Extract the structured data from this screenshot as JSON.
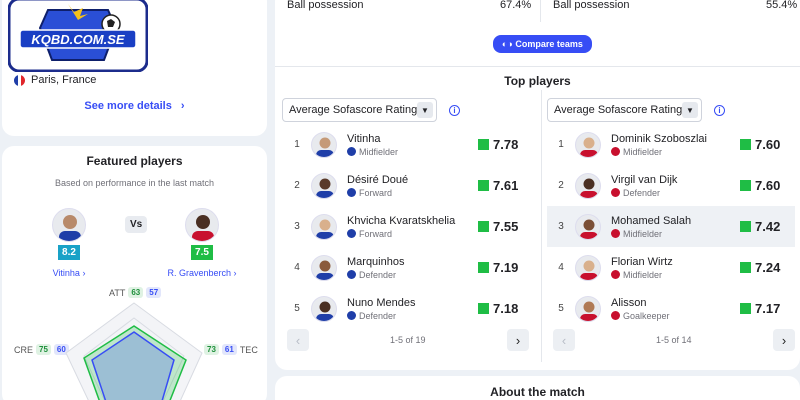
{
  "venue": {
    "logo_text": "KQBD.COM.SE",
    "place": "Paris, France",
    "see_more": "See more details",
    "flag_colors": [
      "#1f3ea8",
      "#ffffff",
      "#e0262b"
    ]
  },
  "featured": {
    "title": "Featured players",
    "subtitle": "Based on performance in the last match",
    "vs": "Vs",
    "home": {
      "name": "Vitinha",
      "rating": "8.2",
      "rating_color": "#19a2c7"
    },
    "away": {
      "name": "R. Gravenberch",
      "rating": "7.5",
      "rating_color": "#1fbd45"
    },
    "radar": {
      "att": {
        "label": "ATT",
        "home": "63",
        "away": "57"
      },
      "cre": {
        "label": "CRE",
        "home": "75",
        "away": "60"
      },
      "tec": {
        "label": "TEC",
        "home": "73",
        "away": "61"
      }
    }
  },
  "possession": {
    "left": {
      "label": "Ball possession",
      "value": "67.4%"
    },
    "right": {
      "label": "Ball possession",
      "value": "55.4%"
    }
  },
  "compare_button": "Compare teams",
  "top_players": {
    "title": "Top players",
    "left": {
      "dropdown": "Average Sofascore Rating",
      "club_color": "#1f3ea8",
      "players": [
        {
          "rank": "1",
          "name": "Vitinha",
          "position": "Midfielder",
          "rating": "7.78"
        },
        {
          "rank": "2",
          "name": "Désiré Doué",
          "position": "Forward",
          "rating": "7.61"
        },
        {
          "rank": "3",
          "name": "Khvicha Kvaratskhelia",
          "position": "Forward",
          "rating": "7.55"
        },
        {
          "rank": "4",
          "name": "Marquinhos",
          "position": "Defender",
          "rating": "7.19"
        },
        {
          "rank": "5",
          "name": "Nuno Mendes",
          "position": "Defender",
          "rating": "7.18"
        }
      ],
      "pager": "1-5 of 19"
    },
    "right": {
      "dropdown": "Average Sofascore Rating",
      "club_color": "#c8102e",
      "players": [
        {
          "rank": "1",
          "name": "Dominik Szoboszlai",
          "position": "Midfielder",
          "rating": "7.60"
        },
        {
          "rank": "2",
          "name": "Virgil van Dijk",
          "position": "Defender",
          "rating": "7.60"
        },
        {
          "rank": "3",
          "name": "Mohamed Salah",
          "position": "Midfielder",
          "rating": "7.42"
        },
        {
          "rank": "4",
          "name": "Florian Wirtz",
          "position": "Midfielder",
          "rating": "7.24"
        },
        {
          "rank": "5",
          "name": "Alisson",
          "position": "Goalkeeper",
          "rating": "7.17"
        }
      ],
      "pager": "1-5 of 14"
    }
  },
  "about": {
    "title": "About the match"
  }
}
